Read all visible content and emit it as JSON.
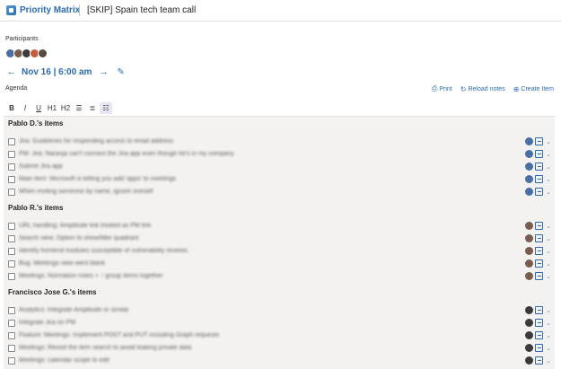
{
  "header": {
    "app_name": "Priority Matrix",
    "document_title": "[SKIP] Spain tech team call"
  },
  "participants": {
    "label": "Participants",
    "avatar_colors": [
      "#4a6fa5",
      "#7a5c4f",
      "#3b3b3b",
      "#c65d3b",
      "#5a4a42"
    ]
  },
  "date_nav": {
    "prev_icon": "arrow-left-icon",
    "date_label": "Nov 16 | 6:00 am",
    "next_icon": "arrow-right-icon",
    "edit_icon": "pencil-icon"
  },
  "agenda": {
    "label": "Agenda",
    "actions": {
      "print": "Print",
      "reload": "Reload notes",
      "create": "Create Item"
    }
  },
  "toolbar": {
    "bold": "B",
    "italic": "I",
    "underline": "U",
    "h1": "H1",
    "h2": "H2",
    "bullets_icon": "bullet-list-icon",
    "numbered_icon": "numbered-list-icon",
    "checklist_icon": "checklist-icon"
  },
  "sections": [
    {
      "title": "Pablo D.'s items",
      "items": [
        "Jira: Guidelines for responding access to email address",
        "PM: Jira: Naranja can't connect the Jira app even though he's in my company",
        "Submit Jira app",
        "Main item: Microsoft is letting you add 'apps' to meetings",
        "When inviting someone by name, ignore oneself"
      ]
    },
    {
      "title": "Pablo R.'s items",
      "items": [
        "URL handling: Amplitude link treated as PM link",
        "Search view: Option to show/filter quadrant",
        "Identify frontend modules susceptible of vulnerability reviews",
        "Bug: Meetings view went blank",
        "Meetings: Normalize notes + ↑ group items together"
      ]
    },
    {
      "title": "Francisco Jose G.'s items",
      "items": [
        "Analytics: Integrate Amplitude or similar",
        "Integrate Jira on PM",
        "Feature: Meetings: Implement POST and PUT including Graph requests",
        "Meetings: Revisit the item search to avoid leaking private data",
        "Meetings: calendar scope to edit"
      ]
    }
  ],
  "colors": {
    "accent": "#2b6cb0",
    "editor_bg": "#f3f2f1"
  }
}
